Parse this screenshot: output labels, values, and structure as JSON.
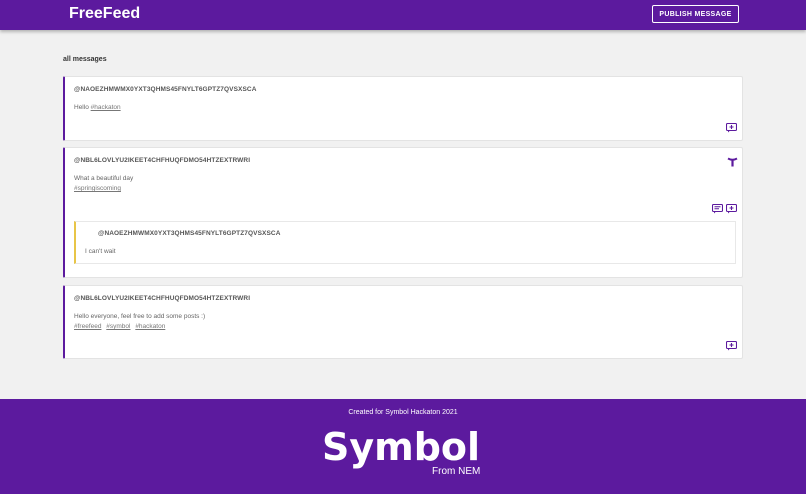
{
  "header": {
    "title": "FreeFeed",
    "publish_label": "PUBLISH MESSAGE"
  },
  "feed": {
    "section_title": "all messages",
    "posts": [
      {
        "author": "@NAOEZHMWMX0YXT3QHMS45FNYLT6GPTZ7QVSXSCA",
        "text": "Hello",
        "tags": [
          "#hackaton"
        ]
      },
      {
        "author": "@NBL6LOVLYU2IKEET4CHFHUQFDMO54HTZEXTRWRI",
        "text": "What a beautiful day",
        "tags": [
          "#springiscoming"
        ],
        "reply": {
          "author": "@NAOEZHMWMX0YXT3QHMS45FNYLT6GPTZ7QVSXSCA",
          "text": "I can't wait"
        }
      },
      {
        "author": "@NBL6LOVLYU2IKEET4CHFHUQFDMO54HTZEXTRWRI",
        "text": "Hello everyone, feel free to add some posts :)",
        "tags": [
          "#freefeed",
          "#symbol",
          "#hackaton"
        ]
      }
    ]
  },
  "icons": {
    "add_comment": "add-comment-icon",
    "comments": "comments-icon",
    "symbol_badge": "symbol-logo-icon"
  },
  "footer": {
    "caption": "Created for Symbol Hackaton 2021",
    "logo_word": "Symbol",
    "logo_sub": "From NEM"
  },
  "colors": {
    "primary": "#5c1a9e",
    "reply_accent": "#e8c547",
    "background": "#f1f1f1"
  }
}
